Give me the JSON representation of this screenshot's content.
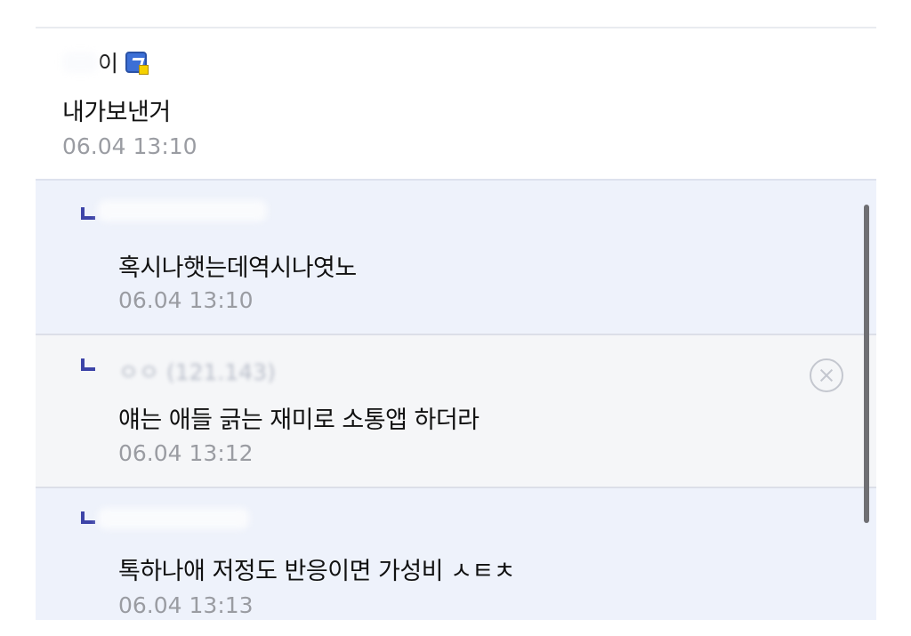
{
  "comments": {
    "main": {
      "nickname": "이",
      "text": "내가보낸거",
      "date": "06.04 13:10"
    },
    "replies": [
      {
        "nickname": "",
        "text": "혹시나햇는데역시나엿노",
        "date": "06.04 13:10"
      },
      {
        "nickname": "ㅇㅇ (121.143)",
        "text": "얘는 애들 긁는 재미로 소통앱 하더라",
        "date": "06.04 13:12"
      },
      {
        "nickname": "",
        "text": "톡하나애 저정도 반응이면 가성비 ㅅㅌㅊ",
        "date": "06.04 13:13"
      }
    ]
  },
  "icons": {
    "gallery_badge": "fixed-member-badge-icon",
    "reply_marker": "reply-arrow-icon",
    "delete": "delete-circle-x-icon"
  },
  "colors": {
    "reply_bg": "#eef2fb",
    "reply_marker": "#3d44a8",
    "date_text": "#9a9ca2"
  }
}
